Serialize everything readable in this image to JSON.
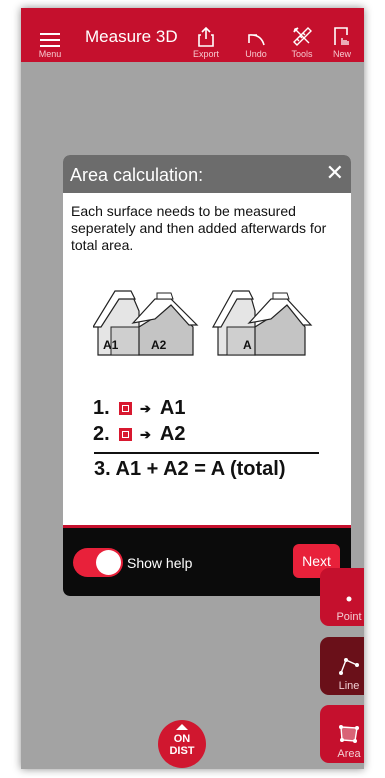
{
  "topbar": {
    "title": "Measure 3D",
    "menu_label": "Menu",
    "export_label": "Export",
    "undo_label": "Undo",
    "tools_label": "Tools",
    "new_label": "New"
  },
  "dialog": {
    "title": "Area calculation:",
    "close_glyph": "✕",
    "description": "Each surface needs to be measured seperately and then added afterwards for total area.",
    "illustration": {
      "house1_labels": [
        "A1",
        "A2"
      ],
      "house2_label": "A"
    },
    "steps": [
      {
        "num": "1.",
        "result": "A1"
      },
      {
        "num": "2.",
        "result": "A2"
      }
    ],
    "arrow_glyph": "➔",
    "total": "3. A1 + A2 = A (total)",
    "show_help_label": "Show help",
    "show_help_on": true,
    "next_label": "Next"
  },
  "tools": {
    "point_label": "Point",
    "line_label": "Line",
    "area_label": "Area"
  },
  "ondist": {
    "line1": "ON",
    "line2": "DIST"
  },
  "colors": {
    "brand_red": "#c5102d",
    "bright_red": "#e8213a",
    "background_gray": "#a3a3a3",
    "dialog_header": "#6c6c6c"
  }
}
